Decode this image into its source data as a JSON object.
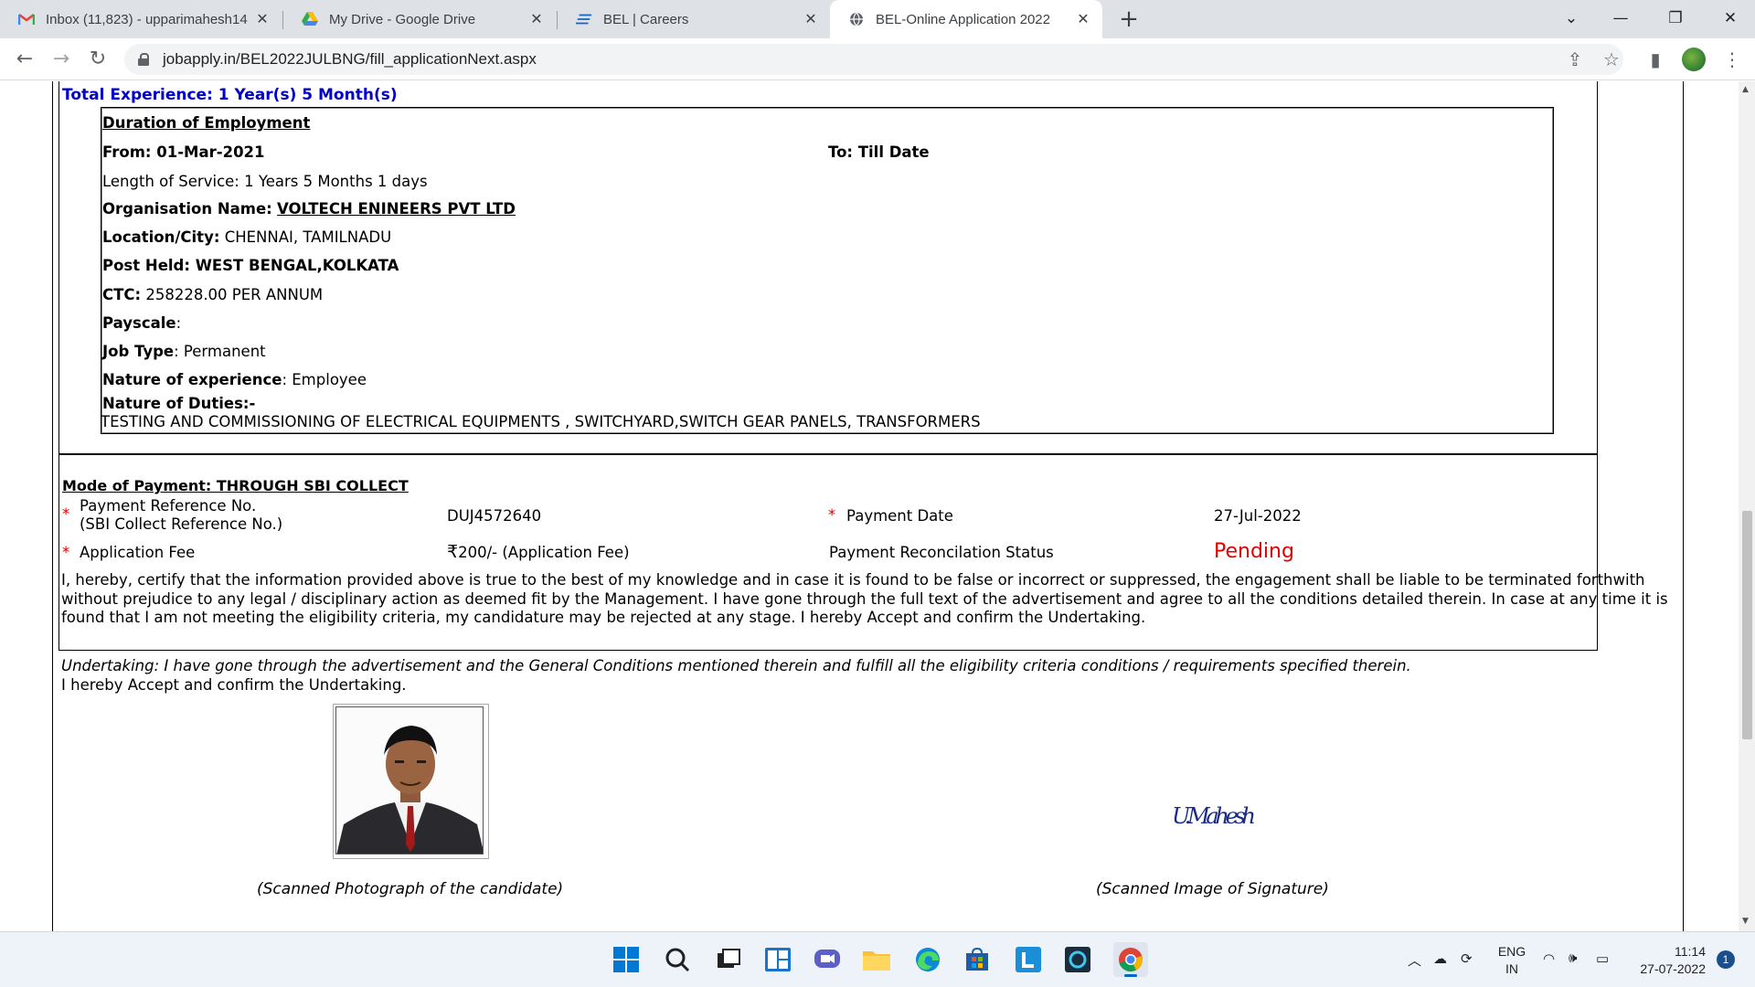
{
  "browser": {
    "tabs": [
      {
        "title": "Inbox (11,823) - upparimahesh14",
        "icon": "gmail-icon"
      },
      {
        "title": "My Drive - Google Drive",
        "icon": "google-drive-icon"
      },
      {
        "title": "BEL | Careers",
        "icon": "bel-logo-icon"
      },
      {
        "title": "BEL-Online Application 2022",
        "icon": "globe-icon"
      }
    ],
    "url": "jobapply.in/BEL2022JULBNG/fill_applicationNext.aspx"
  },
  "experience": {
    "total": "Total Experience: 1 Year(s) 5 Month(s)",
    "duration_heading": "Duration of Employment",
    "from_label": "From:",
    "from_value": "01-Mar-2021",
    "to_label": "To:",
    "to_value": "Till Date",
    "length_of_service": "Length of Service: 1 Years 5 Months 1 days",
    "org_label": "Organisation Name:",
    "org_value": "VOLTECH ENINEERS PVT LTD",
    "location_label": "Location/City:",
    "location_value": "CHENNAI, TAMILNADU",
    "post_label": "Post Held:",
    "post_value": "WEST BENGAL,KOLKATA",
    "ctc_label": "CTC:",
    "ctc_value": "258228.00 PER ANNUM",
    "payscale_label": "Payscale",
    "payscale_value": ":",
    "jobtype_label": "Job Type",
    "jobtype_value": ": Permanent",
    "nature_label": "Nature of experience",
    "nature_value": ": Employee",
    "duties_label": "Nature of Duties:-",
    "duties_value": "TESTING AND COMMISSIONING OF ELECTRICAL EQUIPMENTS , SWITCHYARD,SWITCH GEAR PANELS, TRANSFORMERS"
  },
  "payment": {
    "mode_label": "Mode of Payment: THROUGH SBI COLLECT",
    "ref_label_1": "Payment Reference No.",
    "ref_label_2": "(SBI Collect Reference No.)",
    "ref_value": "DUJ4572640",
    "date_label": "Payment Date",
    "date_value": "27-Jul-2022",
    "fee_label": "Application Fee",
    "fee_value": "200/- (Application Fee)",
    "rupee": "₹",
    "status_label": "Payment Reconcilation Status",
    "status_value": "Pending",
    "required_mark": "*"
  },
  "declaration": "I, hereby, certify that the information provided above is true to the best of my knowledge and in case it is found to be false or incorrect or suppressed, the engagement shall be liable to be terminated forthwith without prejudice to any legal / disciplinary action as deemed fit by the Management. I have gone through the full text of the advertisement and agree to all the conditions detailed therein. In case at any time it is found that I am not meeting the eligibility criteria, my candidature may be rejected at any stage. I hereby Accept and confirm the Undertaking.",
  "undertaking_italic": "Undertaking: I have gone through the advertisement and the General Conditions mentioned therein and fulfill all the eligibility criteria conditions / requirements specified therein.",
  "undertaking_plain": "I hereby Accept and confirm the Undertaking.",
  "photo_caption": "(Scanned Photograph of the candidate)",
  "signature_caption": "(Scanned Image of Signature)",
  "signature_text": "U.Mahesh",
  "taskbar": {
    "lang_1": "ENG",
    "lang_2": "IN",
    "time": "11:14",
    "date": "27-07-2022",
    "notifications": "1"
  }
}
